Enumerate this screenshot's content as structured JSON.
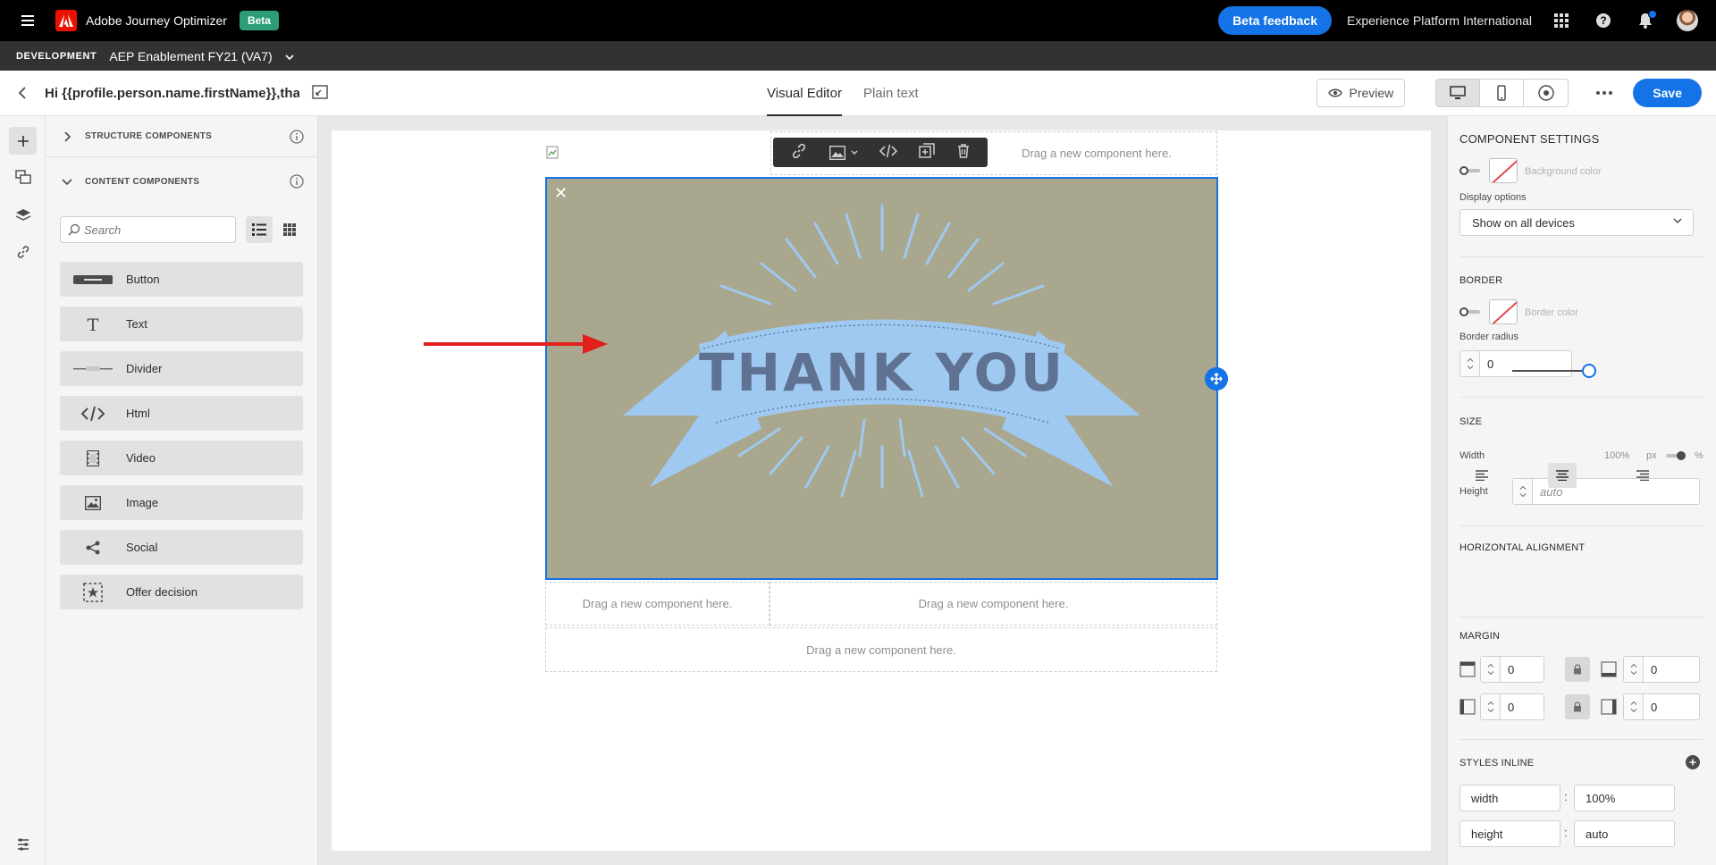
{
  "app": {
    "name": "Adobe Journey Optimizer",
    "beta_label": "Beta",
    "feedback_label": "Beta feedback",
    "org": "Experience Platform International"
  },
  "sandbox": {
    "env": "DEVELOPMENT",
    "name": "AEP Enablement FY21 (VA7)"
  },
  "header": {
    "title": "Hi {{profile.person.name.firstName}},than...",
    "tabs": [
      {
        "label": "Visual Editor",
        "active": true
      },
      {
        "label": "Plain text",
        "active": false
      }
    ],
    "preview_label": "Preview",
    "save_label": "Save"
  },
  "left_panel": {
    "structure_label": "STRUCTURE COMPONENTS",
    "content_label": "CONTENT COMPONENTS",
    "search_placeholder": "Search",
    "components": [
      {
        "label": "Button",
        "icon": "button-icon"
      },
      {
        "label": "Text",
        "icon": "text-icon"
      },
      {
        "label": "Divider",
        "icon": "divider-icon"
      },
      {
        "label": "Html",
        "icon": "code-icon"
      },
      {
        "label": "Video",
        "icon": "video-icon"
      },
      {
        "label": "Image",
        "icon": "image-icon"
      },
      {
        "label": "Social",
        "icon": "share-icon"
      },
      {
        "label": "Offer decision",
        "icon": "offer-icon"
      }
    ]
  },
  "canvas": {
    "dropzone_top": "Drag a new component here.",
    "dropzone_text": "Drag a new component here.",
    "image_text": "THANK YOU"
  },
  "settings": {
    "title": "COMPONENT SETTINGS",
    "background_color_label": "Background color",
    "display_options_label": "Display options",
    "display_options_value": "Show on all devices",
    "border_label": "BORDER",
    "border_color_label": "Border color",
    "border_radius_label": "Border radius",
    "border_radius_value": "0",
    "size_label": "SIZE",
    "width_label": "Width",
    "width_value": "100%",
    "width_fraction": 1.0,
    "unit_px": "px",
    "unit_pct": "%",
    "height_label": "Height",
    "height_placeholder": "auto",
    "halign_label": "HORIZONTAL ALIGNMENT",
    "margin_label": "MARGIN",
    "margins": {
      "top": "0",
      "bottom": "0",
      "left": "0",
      "right": "0"
    },
    "styles_inline_label": "STYLES INLINE",
    "styles": [
      {
        "key": "width",
        "value": "100%"
      },
      {
        "key": "height",
        "value": "auto"
      }
    ]
  },
  "colors": {
    "accent": "#1473e6",
    "arrow": "#e3201b",
    "image_bg": "#a9a78e",
    "ribbon": "#9fc9f1"
  }
}
